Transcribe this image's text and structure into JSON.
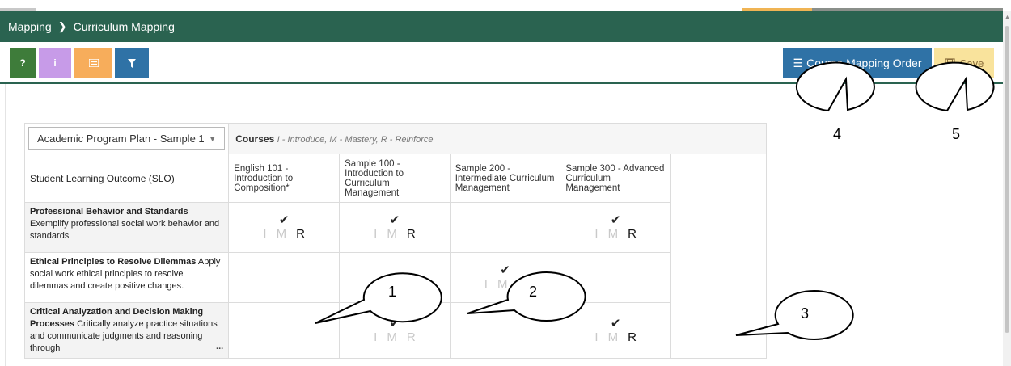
{
  "breadcrumb": {
    "parent": "Mapping",
    "separator": "›",
    "current": "Curriculum Mapping"
  },
  "toolbar": {
    "help_label": "?",
    "info_label": "i",
    "order_label": "Course Mapping Order",
    "save_label": "Save"
  },
  "plan_select": {
    "value": "Academic Program Plan - Sample 1"
  },
  "courses_header": {
    "title": "Courses",
    "legend": "I - Introduce, M - Mastery, R - Reinforce"
  },
  "slo_header": "Student Learning Outcome (SLO)",
  "courses": [
    "English 101 - Introduction to Composition*",
    "Sample 100 - Introduction to Curriculum Management",
    "Sample 200 - Intermediate Curriculum Management",
    "Sample 300 - Advanced Curriculum Management"
  ],
  "letters": {
    "i": "I",
    "m": "M",
    "r": "R"
  },
  "outcomes": [
    {
      "title": "Professional Behavior and Standards",
      "description": "Exemplify professional social work behavior and standards"
    },
    {
      "title": "Ethical Principles to Resolve Dilemmas",
      "description": "Apply social work ethical principles to resolve dilemmas and create positive changes."
    },
    {
      "title": "Critical Analyzation and Decision Making Processes",
      "description": "Critically analyze practice situations and communicate judgments and reasoning through",
      "more": "..."
    }
  ],
  "callouts": [
    "1",
    "2",
    "3",
    "4",
    "5"
  ]
}
